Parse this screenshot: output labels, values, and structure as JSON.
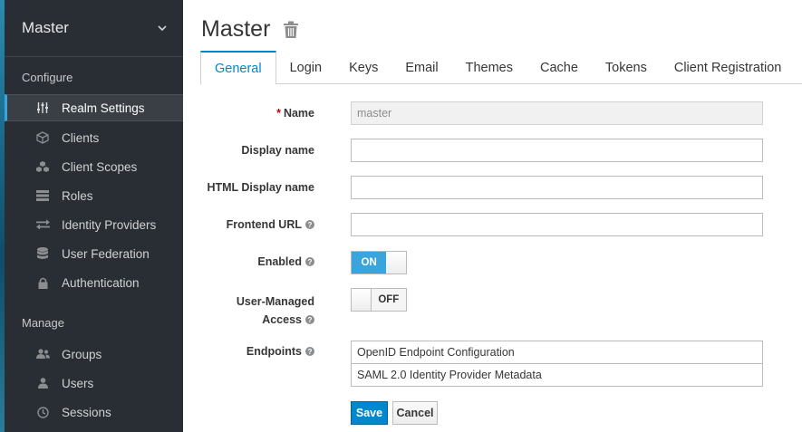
{
  "sidebar": {
    "realm_selector": "Master",
    "sections": {
      "configure": "Configure",
      "manage": "Manage"
    },
    "configure_items": [
      {
        "label": "Realm Settings",
        "icon": "sliders-icon",
        "active": true
      },
      {
        "label": "Clients",
        "icon": "cube-icon"
      },
      {
        "label": "Client Scopes",
        "icon": "cubes-icon"
      },
      {
        "label": "Roles",
        "icon": "list-icon"
      },
      {
        "label": "Identity Providers",
        "icon": "exchange-icon"
      },
      {
        "label": "User Federation",
        "icon": "database-icon"
      },
      {
        "label": "Authentication",
        "icon": "lock-icon"
      }
    ],
    "manage_items": [
      {
        "label": "Groups",
        "icon": "users-icon"
      },
      {
        "label": "Users",
        "icon": "user-icon"
      },
      {
        "label": "Sessions",
        "icon": "clock-icon"
      }
    ]
  },
  "header": {
    "title": "Master"
  },
  "tabs": [
    "General",
    "Login",
    "Keys",
    "Email",
    "Themes",
    "Cache",
    "Tokens",
    "Client Registration"
  ],
  "form": {
    "required_mark": "*",
    "name_label": "Name",
    "name_value": "master",
    "display_name_label": "Display name",
    "display_name_value": "",
    "html_display_name_label": "HTML Display name",
    "html_display_name_value": "",
    "frontend_url_label": "Frontend URL",
    "frontend_url_value": "",
    "enabled_label": "Enabled",
    "enabled_state": "ON",
    "user_managed_label_1": "User-Managed",
    "user_managed_label_2": "Access",
    "user_managed_state": "OFF",
    "endpoints_label": "Endpoints",
    "endpoints": [
      "OpenID Endpoint Configuration",
      "SAML 2.0 Identity Provider Metadata"
    ]
  },
  "actions": {
    "save": "Save",
    "cancel": "Cancel"
  },
  "colors": {
    "accent": "#0088ce",
    "toggle_on": "#39a5dc",
    "sidebar_bg": "#292e34",
    "required": "#cc0000"
  }
}
